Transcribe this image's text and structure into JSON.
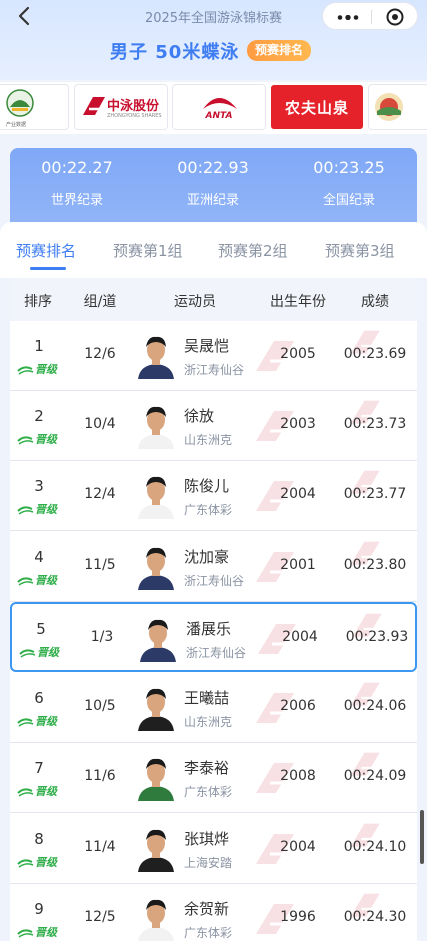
{
  "header": {
    "competition": "2025年全国游泳锦标赛",
    "event": "男子 50米蝶泳",
    "badge": "预赛排名"
  },
  "sponsors": [
    {
      "name": "产业数据",
      "text": "产业数据"
    },
    {
      "name": "中泳股份",
      "text": "中泳股份",
      "sub": "ZHONGYONG SHARES"
    },
    {
      "name": "ANTA",
      "text": "ANTA"
    },
    {
      "name": "农夫山泉",
      "text": "农夫山泉"
    },
    {
      "name": "sponsor-5"
    }
  ],
  "records": [
    {
      "time": "00:22.27",
      "label": "世界纪录"
    },
    {
      "time": "00:22.93",
      "label": "亚洲纪录"
    },
    {
      "time": "00:23.25",
      "label": "全国纪录"
    }
  ],
  "tabs": [
    "预赛排名",
    "预赛第1组",
    "预赛第2组",
    "预赛第3组"
  ],
  "active_tab": 0,
  "table": {
    "headers": [
      "排序",
      "组/道",
      "运动员",
      "出生年份",
      "成绩"
    ],
    "qualify_label": "晋级",
    "rows": [
      {
        "rank": "1",
        "lane": "12/6",
        "name": "吴晟恺",
        "team": "浙江寿仙谷",
        "year": "2005",
        "result": "00:23.69",
        "kit": "navy"
      },
      {
        "rank": "2",
        "lane": "10/4",
        "name": "徐放",
        "team": "山东洲克",
        "year": "2003",
        "result": "00:23.73",
        "kit": "white"
      },
      {
        "rank": "3",
        "lane": "12/4",
        "name": "陈俊儿",
        "team": "广东体彩",
        "year": "2004",
        "result": "00:23.77",
        "kit": "white"
      },
      {
        "rank": "4",
        "lane": "11/5",
        "name": "沈加豪",
        "team": "浙江寿仙谷",
        "year": "2001",
        "result": "00:23.80",
        "kit": "navy"
      },
      {
        "rank": "5",
        "lane": "1/3",
        "name": "潘展乐",
        "team": "浙江寿仙谷",
        "year": "2004",
        "result": "00:23.93",
        "kit": "navy"
      },
      {
        "rank": "6",
        "lane": "10/5",
        "name": "王曦喆",
        "team": "山东洲克",
        "year": "2006",
        "result": "00:24.06",
        "kit": "black"
      },
      {
        "rank": "7",
        "lane": "11/6",
        "name": "李泰裕",
        "team": "广东体彩",
        "year": "2008",
        "result": "00:24.09",
        "kit": "green"
      },
      {
        "rank": "8",
        "lane": "11/4",
        "name": "张琪烨",
        "team": "上海安踏",
        "year": "2004",
        "result": "00:24.10",
        "kit": "black"
      },
      {
        "rank": "9",
        "lane": "12/5",
        "name": "余贺新",
        "team": "广东体彩",
        "year": "1996",
        "result": "00:24.30",
        "kit": "white"
      }
    ]
  },
  "colors": {
    "accent": "#3f7df3",
    "badge": "#ff9b42",
    "qualify": "#2fae4a",
    "highlight_border": "#3c97f2"
  }
}
